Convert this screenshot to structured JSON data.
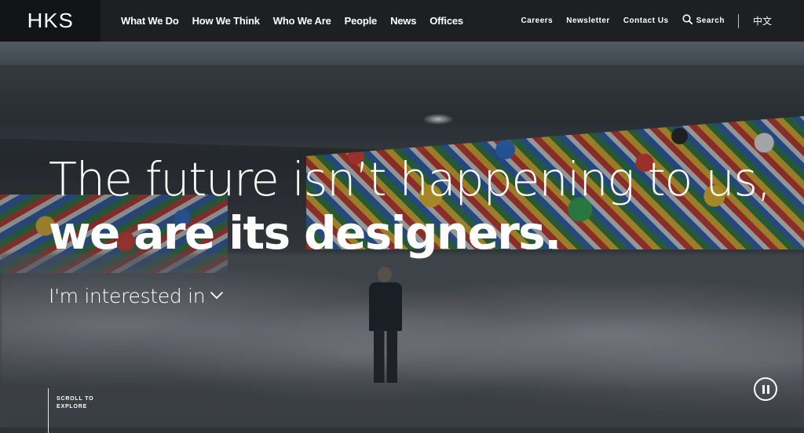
{
  "header": {
    "logo": "HKS",
    "main_nav": [
      "What We Do",
      "How We Think",
      "Who We Are",
      "People",
      "News",
      "Offices"
    ],
    "utility_nav": {
      "careers": "Careers",
      "newsletter": "Newsletter",
      "contact": "Contact Us",
      "search": "Search",
      "language": "中文"
    }
  },
  "hero": {
    "headline_line1": "The future isn’t happening to us,",
    "headline_line2": "we are its designers.",
    "interest_label": "I'm interested in",
    "scroll_label_1": "SCROLL TO",
    "scroll_label_2": "EXPLORE"
  },
  "icons": {
    "search": "search-icon",
    "chevron": "chevron-down-icon",
    "pause": "pause-icon"
  },
  "colors": {
    "header_bg": "#1e1f21",
    "logo_bg": "#131415",
    "text": "#ffffff"
  }
}
